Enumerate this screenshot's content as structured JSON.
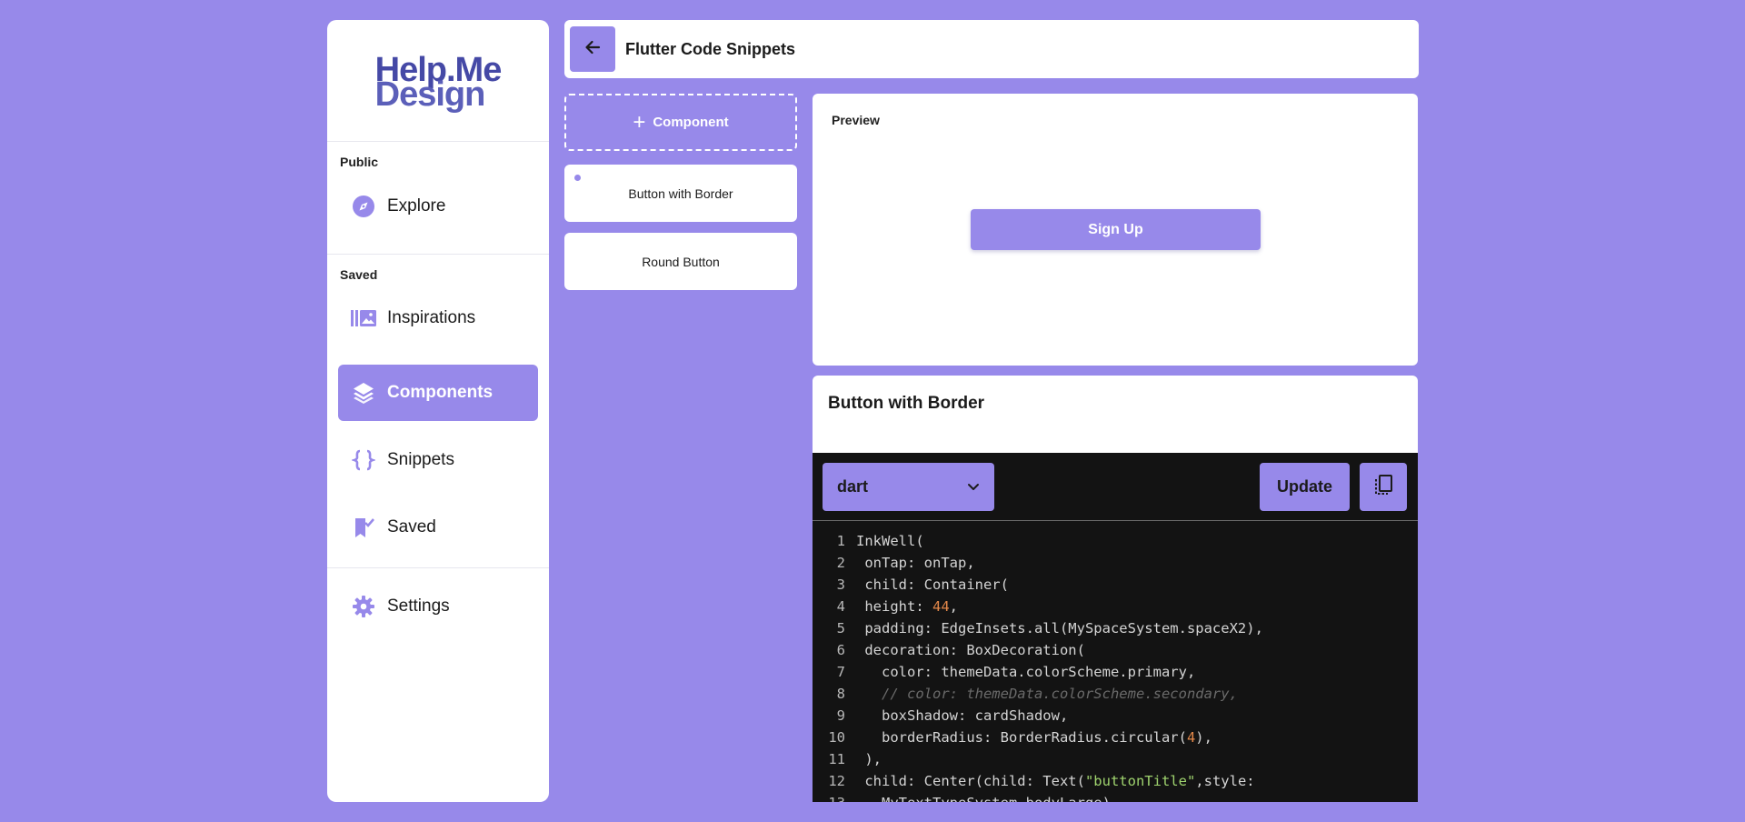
{
  "sidebar": {
    "logo_line1": "Help.Me",
    "logo_line2": "Design",
    "section_public": "Public",
    "section_saved": "Saved",
    "items": [
      {
        "label": "Explore",
        "icon": "compass-icon",
        "active": false
      },
      {
        "label": "Inspirations",
        "icon": "gallery-icon",
        "active": false
      },
      {
        "label": "Components",
        "icon": "layers-icon",
        "active": true
      },
      {
        "label": "Snippets",
        "icon": "braces-icon",
        "active": false
      },
      {
        "label": "Saved",
        "icon": "bookmark-check-icon",
        "active": false
      },
      {
        "label": "Settings",
        "icon": "gear-icon",
        "active": false
      }
    ]
  },
  "header": {
    "back_icon": "arrow-left-icon",
    "title": "Flutter Code Snippets"
  },
  "components": {
    "add_label": "Component",
    "items": [
      {
        "label": "Button with Border",
        "selected": true
      },
      {
        "label": "Round Button",
        "selected": false
      }
    ]
  },
  "preview": {
    "label": "Preview",
    "button_label": "Sign Up"
  },
  "code": {
    "title": "Button with Border",
    "language": "dart",
    "update_label": "Update",
    "copy_icon": "copy-icon",
    "lines": [
      "InkWell(",
      " onTap: onTap,",
      " child: Container(",
      " height: 44,",
      " padding: EdgeInsets.all(MySpaceSystem.spaceX2),",
      " decoration: BoxDecoration(",
      "   color: themeData.colorScheme.primary,",
      "   // color: themeData.colorScheme.secondary,",
      "   boxShadow: cardShadow,",
      "   borderRadius: BorderRadius.circular(4),",
      " ),",
      " child: Center(child: Text(\"buttonTitle\",style:",
      "   MyTextTypeSystem.bodyLarge),"
    ]
  },
  "colors": {
    "accent": "#9789ea",
    "background": "#9789ea",
    "code_bg": "#131313",
    "logo_navy": "#4549a6"
  }
}
